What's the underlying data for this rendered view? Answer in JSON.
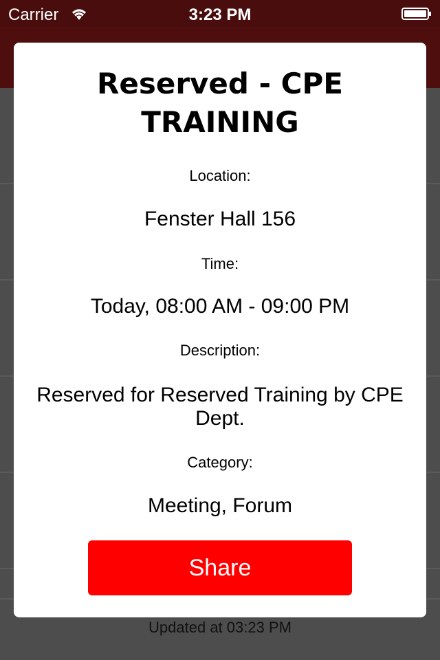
{
  "status_bar": {
    "carrier": "Carrier",
    "time": "3:23 PM"
  },
  "modal": {
    "title": "Reserved - CPE TRAINING",
    "location_label": "Location:",
    "location_value": "Fenster Hall 156",
    "time_label": "Time:",
    "time_value": "Today, 08:00 AM - 09:00 PM",
    "description_label": "Description:",
    "description_value": "Reserved for Reserved Training by CPE Dept.",
    "category_label": "Category:",
    "category_value": "Meeting, Forum",
    "share_label": "Share"
  },
  "footer": {
    "updated_text": "Updated at 03:23 PM"
  },
  "colors": {
    "status_bar_bg": "#4a0d0d",
    "share_button": "#ff0000",
    "overlay": "#4d4d4d"
  }
}
